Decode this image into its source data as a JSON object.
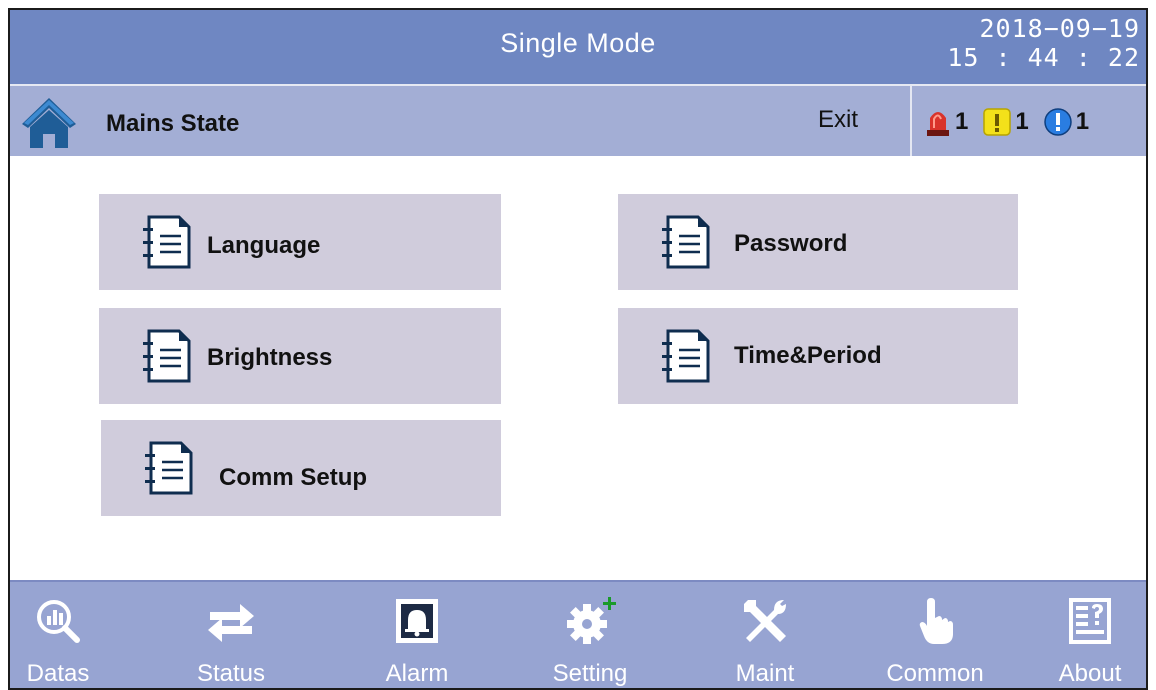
{
  "header": {
    "title": "Single Mode",
    "date": "2018−09−19",
    "time": "15 : 44 : 22"
  },
  "subbar": {
    "state": "Mains State",
    "exit_label": "Exit",
    "alarms": [
      {
        "icon": "siren-icon",
        "count": "1",
        "color": "#d9332b"
      },
      {
        "icon": "warning-icon",
        "count": "1",
        "color": "#f3e11a"
      },
      {
        "icon": "info-icon",
        "count": "1",
        "color": "#2a7de1"
      }
    ]
  },
  "menu": {
    "language": "Language",
    "password": "Password",
    "brightness": "Brightness",
    "time_period": "Time&Period",
    "comm_setup": "Comm Setup"
  },
  "nav": {
    "datas": "Datas",
    "status": "Status",
    "alarm": "Alarm",
    "setting": "Setting",
    "maint": "Maint",
    "common": "Common",
    "about": "About"
  },
  "colors": {
    "titlebar": "#6f87c2",
    "subbar": "#a3aed5",
    "button": "#d0ccdc",
    "bottombar": "#97a4d2",
    "home": "#1f5d97"
  }
}
